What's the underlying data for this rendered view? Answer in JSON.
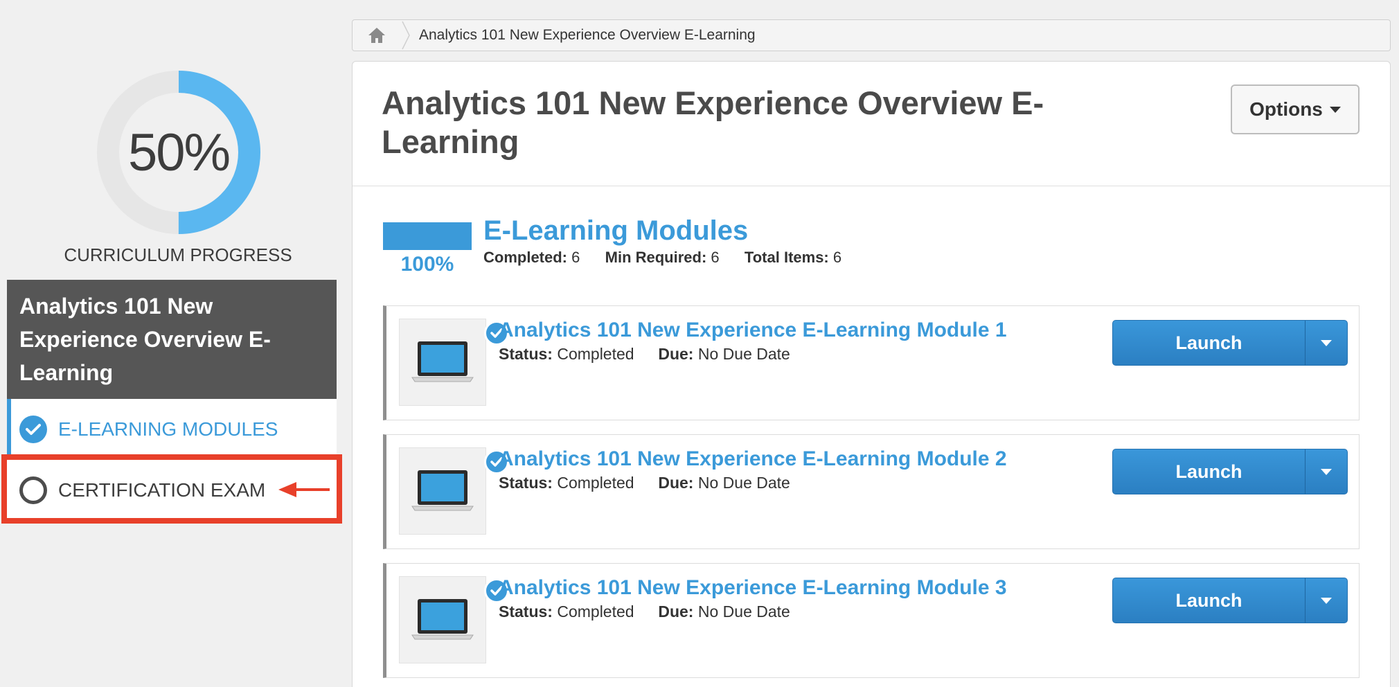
{
  "progress": {
    "value": 0.5,
    "percent_label": "50%",
    "caption": "CURRICULUM PROGRESS",
    "fill_color": "#5ab7f0",
    "track_color": "#e6e6e6"
  },
  "curriculum": {
    "title": "Analytics 101 New Experience Overview E-Learning",
    "items": [
      {
        "label": "E-LEARNING MODULES",
        "state": "completed",
        "icon": "check-circle-icon"
      },
      {
        "label": "CERTIFICATION EXAM",
        "state": "not-started",
        "icon": "empty-circle-icon",
        "highlighted": true
      }
    ]
  },
  "breadcrumb": {
    "home_icon": "home-icon",
    "current": "Analytics 101 New Experience Overview E-Learning"
  },
  "header": {
    "title": "Analytics 101 New Experience Overview E-Learning",
    "options_label": "Options"
  },
  "section": {
    "progress": 1.0,
    "percent_label": "100%",
    "title": "E-Learning Modules",
    "completed_label": "Completed:",
    "completed_value": "6",
    "min_required_label": "Min Required:",
    "min_required_value": "6",
    "total_items_label": "Total Items:",
    "total_items_value": "6"
  },
  "modules": [
    {
      "title": "Analytics 101 New Experience E-Learning Module 1",
      "status_label": "Status:",
      "status_value": "Completed",
      "due_label": "Due:",
      "due_value": "No Due Date",
      "launch_label": "Launch",
      "thumbnail_icon": "laptop-icon"
    },
    {
      "title": "Analytics 101 New Experience E-Learning Module 2",
      "status_label": "Status:",
      "status_value": "Completed",
      "due_label": "Due:",
      "due_value": "No Due Date",
      "launch_label": "Launch",
      "thumbnail_icon": "laptop-icon"
    },
    {
      "title": "Analytics 101 New Experience E-Learning Module 3",
      "status_label": "Status:",
      "status_value": "Completed",
      "due_label": "Due:",
      "due_value": "No Due Date",
      "launch_label": "Launch",
      "thumbnail_icon": "laptop-icon"
    }
  ],
  "colors": {
    "accent": "#3b9ad9",
    "highlight": "#e8402a",
    "panel_dark": "#565656"
  }
}
